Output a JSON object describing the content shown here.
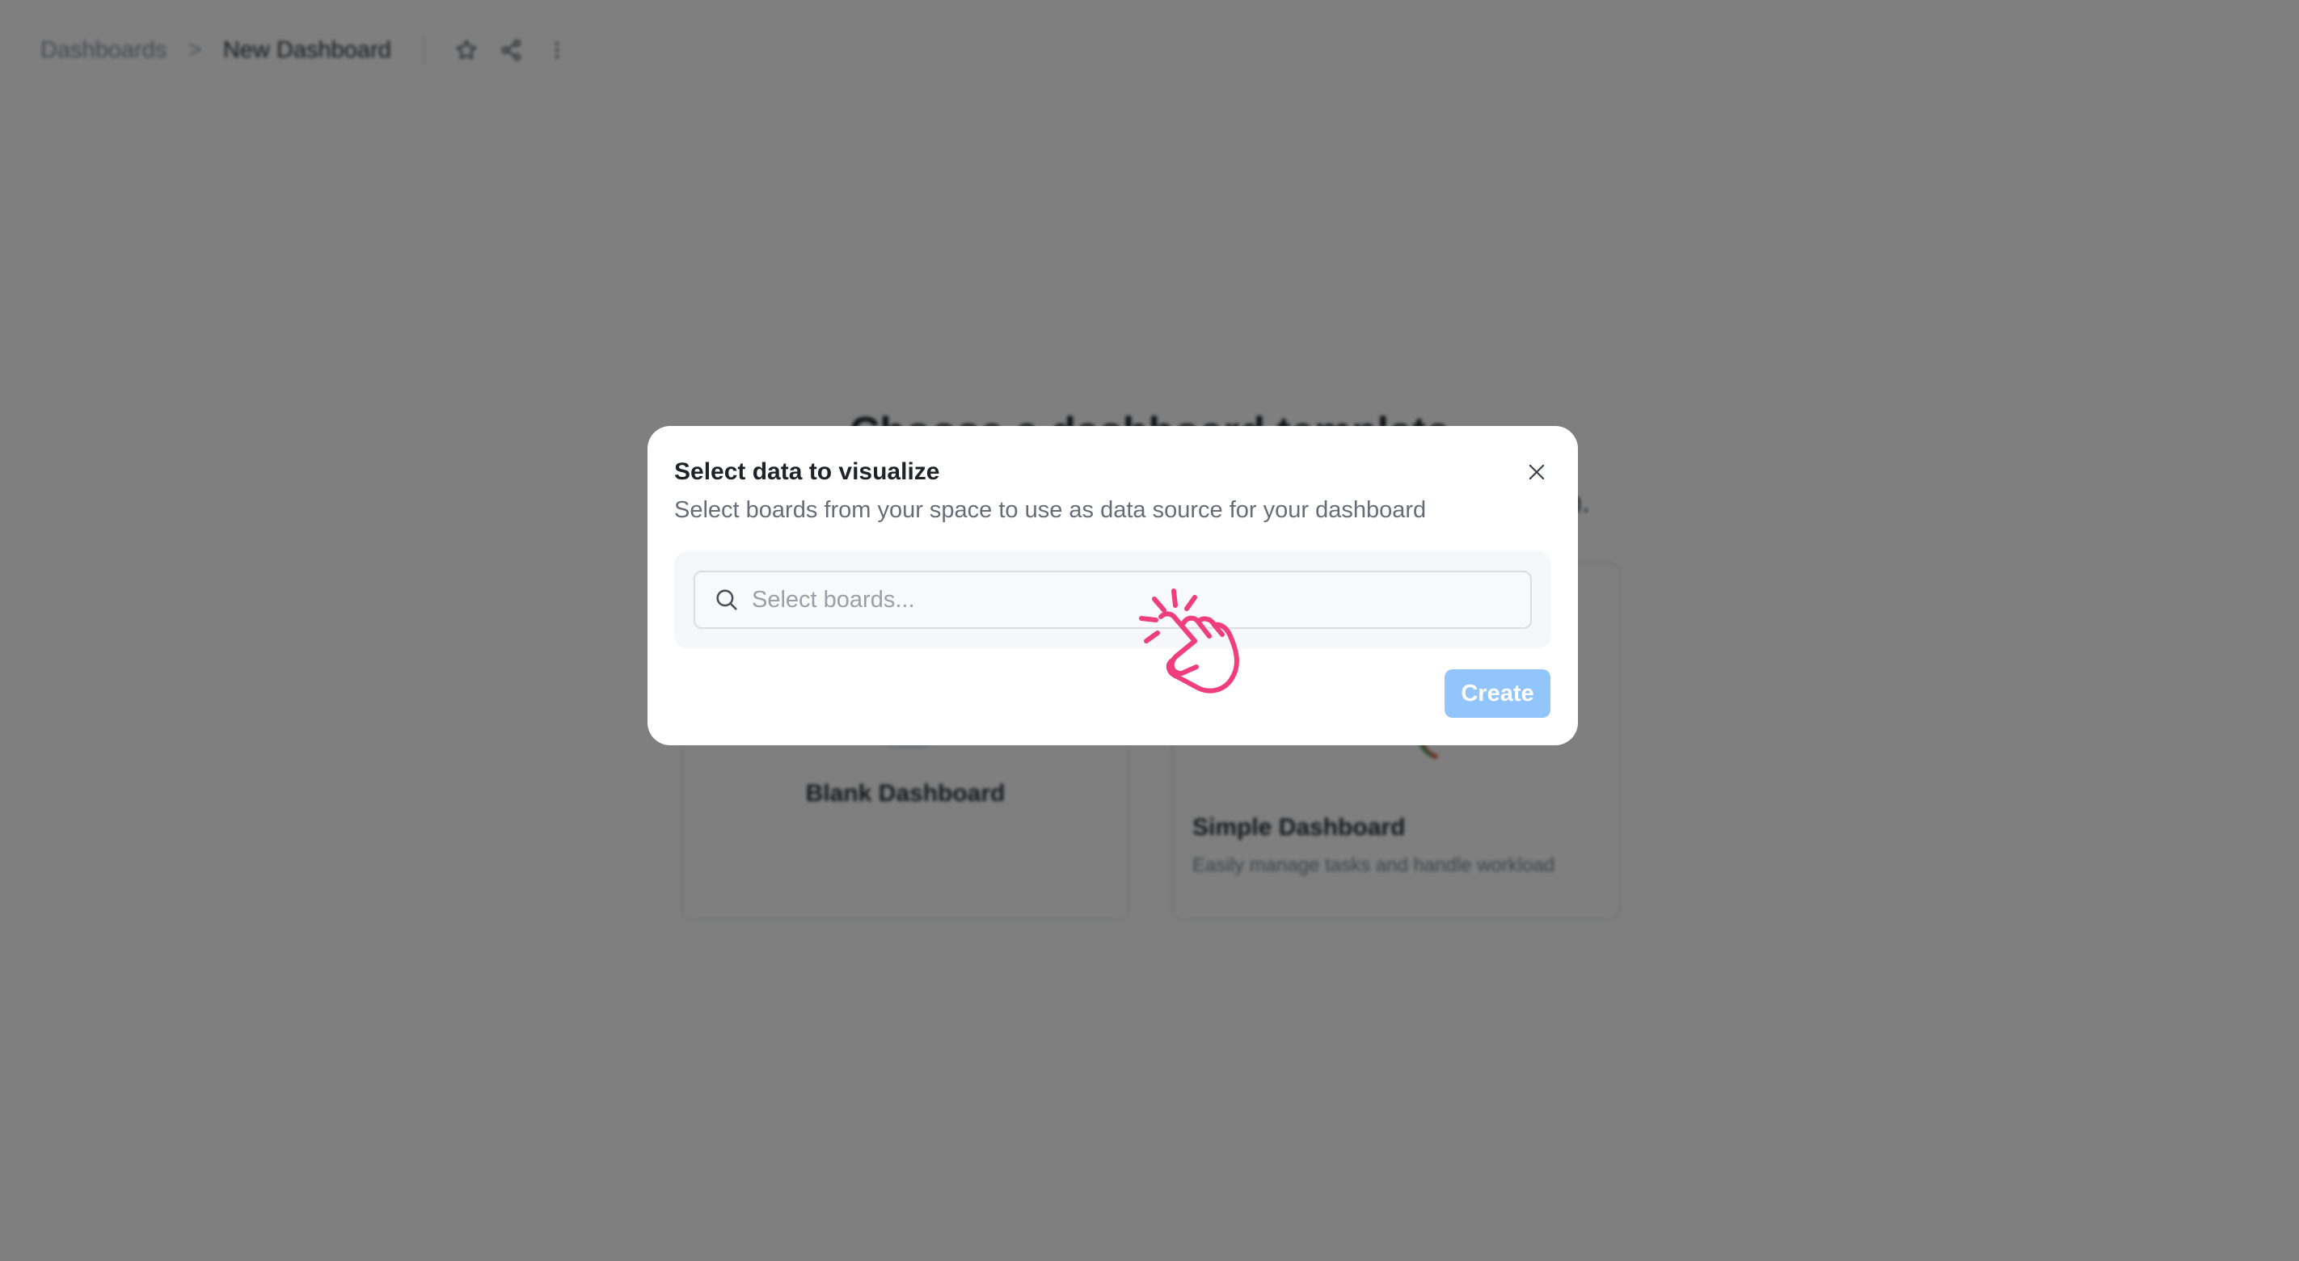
{
  "topbar": {
    "breadcrumb_root": "Dashboards",
    "breadcrumb_separator": ">",
    "breadcrumb_current": "New Dashboard",
    "icons": [
      "star-icon",
      "share-icon",
      "more-vertical-icon"
    ]
  },
  "background": {
    "title": "Choose a dashboard template",
    "subtitle": "n.",
    "cards": [
      {
        "title": "Blank Dashboard",
        "description": ""
      },
      {
        "title": "Simple Dashboard",
        "description": "Easily manage tasks and handle workload"
      }
    ]
  },
  "modal": {
    "title": "Select data to visualize",
    "subtitle": "Select boards from your space to use as data source for your dashboard",
    "search": {
      "placeholder": "Select boards...",
      "value": ""
    },
    "create_label": "Create",
    "close_icon": "close-icon"
  },
  "colors": {
    "overlay": "#000000",
    "create_button": "#93c5fd",
    "hand_cursor": "#ef3e7b"
  }
}
